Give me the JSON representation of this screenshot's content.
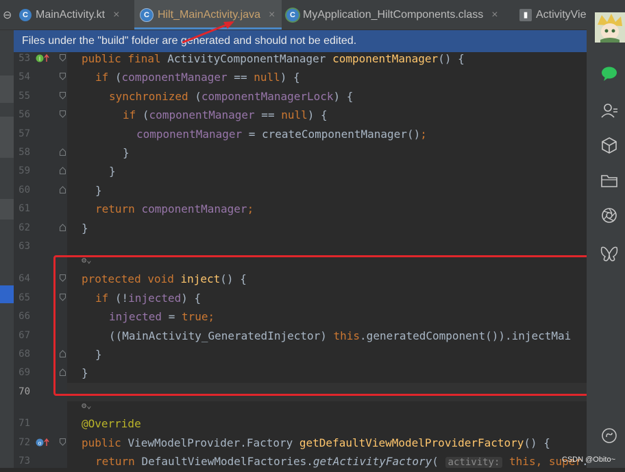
{
  "tabs": [
    {
      "label": "MainActivity.kt",
      "icon": "kotlin-class-icon",
      "active": false
    },
    {
      "label": "Hilt_MainActivity.java",
      "icon": "java-class-icon",
      "active": true
    },
    {
      "label": "MyApplication_HiltComponents.class",
      "icon": "class-file-icon",
      "active": false
    },
    {
      "label": "ActivityVie",
      "icon": "class-file-icon",
      "active": false
    }
  ],
  "tab_close_glyph": "×",
  "banner": {
    "text": "Files under the \"build\" folder are generated and should not be edited."
  },
  "line_numbers": {
    "l53": "53",
    "l54": "54",
    "l55": "55",
    "l56": "56",
    "l57": "57",
    "l58": "58",
    "l59": "59",
    "l60": "60",
    "l61": "61",
    "l62": "62",
    "l63": "63",
    "l64": "64",
    "l65": "65",
    "l66": "66",
    "l67": "67",
    "l68": "68",
    "l69": "69",
    "l70": "70",
    "l71": "71",
    "l72": "72",
    "l73": "73"
  },
  "code": {
    "l53": {
      "a": "public final ",
      "b": "ActivityComponentManager ",
      "c": "componentManager",
      "d": "() {"
    },
    "l54": {
      "a": "if ",
      "b": "(",
      "c": "componentManager",
      "d": " == ",
      "e": "null",
      "f": ") {"
    },
    "l55": {
      "a": "synchronized ",
      "b": "(",
      "c": "componentManagerLock",
      "d": ") {"
    },
    "l56": {
      "a": "if ",
      "b": "(",
      "c": "componentManager",
      "d": " == ",
      "e": "null",
      "f": ") {"
    },
    "l57": {
      "a": "componentManager",
      "b": " = createComponentManager()",
      "c": ";"
    },
    "l58": "}",
    "l59": "}",
    "l60": "}",
    "l61": {
      "a": "return ",
      "b": "componentManager",
      "c": ";"
    },
    "l62": "}",
    "l64": {
      "a": "protected void ",
      "b": "inject",
      "c": "() {"
    },
    "l65": {
      "a": "if ",
      "b": "(!",
      "c": "injected",
      "d": ") {"
    },
    "l66": {
      "a": "injected",
      "b": " = ",
      "c": "true",
      "d": ";"
    },
    "l67": {
      "a": "((MainActivity_GeneratedInjector) ",
      "b": "this",
      "c": ".generatedComponent()).injectMai"
    },
    "l68": "}",
    "l69": "}",
    "l71": "@Override",
    "l72": {
      "a": "public ",
      "b": "ViewModelProvider.Factory ",
      "c": "getDefaultViewModelProviderFactory",
      "d": "() {"
    },
    "l73": {
      "a": "return ",
      "b": "DefaultViewModelFactories.",
      "c": "getActivityFactory",
      "d": "( ",
      "e": "activity:",
      "f": " this",
      "g": ", ",
      "h": "super",
      "i": "."
    }
  },
  "inlay_hint_glyph": "⚙⌄",
  "watermark": "CSDN @Obito~",
  "colors": {
    "keyword": "#cc7832",
    "function": "#ffc66d",
    "field": "#9876aa",
    "annotation": "#bbb529",
    "highlight_box": "#e0262b",
    "banner": "#2f5490"
  }
}
